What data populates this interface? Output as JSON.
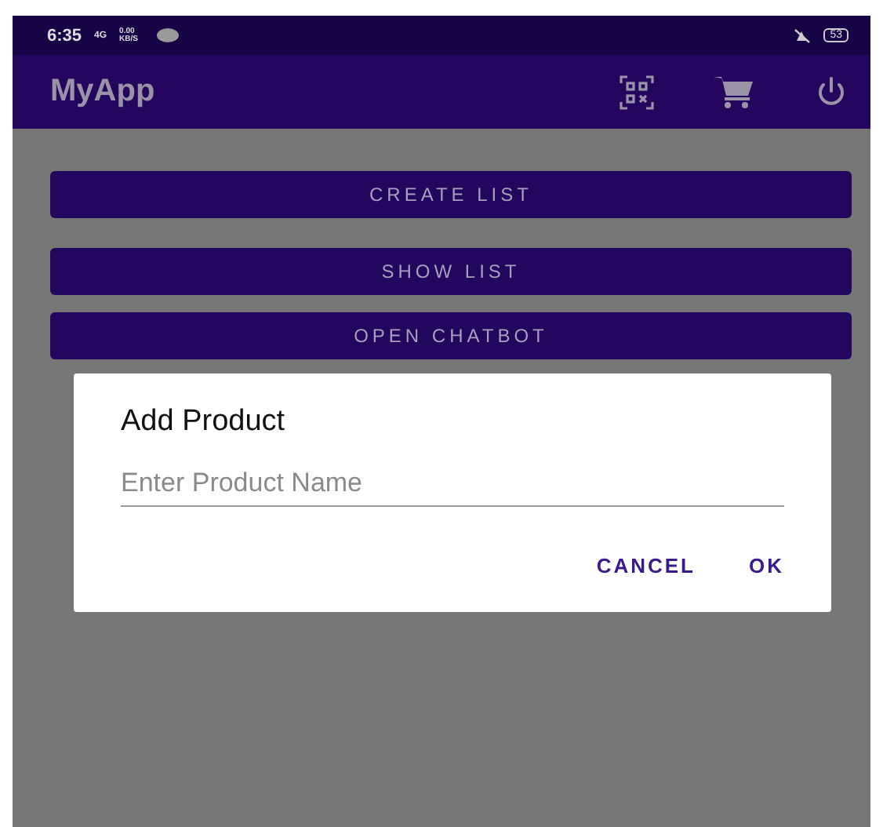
{
  "status_bar": {
    "time": "6:35",
    "network": "4G",
    "speed": "0.00 KB/S",
    "battery": "53"
  },
  "app_bar": {
    "title": "MyApp"
  },
  "buttons": [
    {
      "label": "CREATE LIST"
    },
    {
      "label": "SHOW LIST"
    },
    {
      "label": "OPEN CHATBOT"
    }
  ],
  "dialog": {
    "title": "Add Product",
    "field": {
      "placeholder": "Enter Product Name"
    },
    "actions": [
      {
        "label": "CANCEL"
      },
      {
        "label": "OK"
      }
    ]
  }
}
